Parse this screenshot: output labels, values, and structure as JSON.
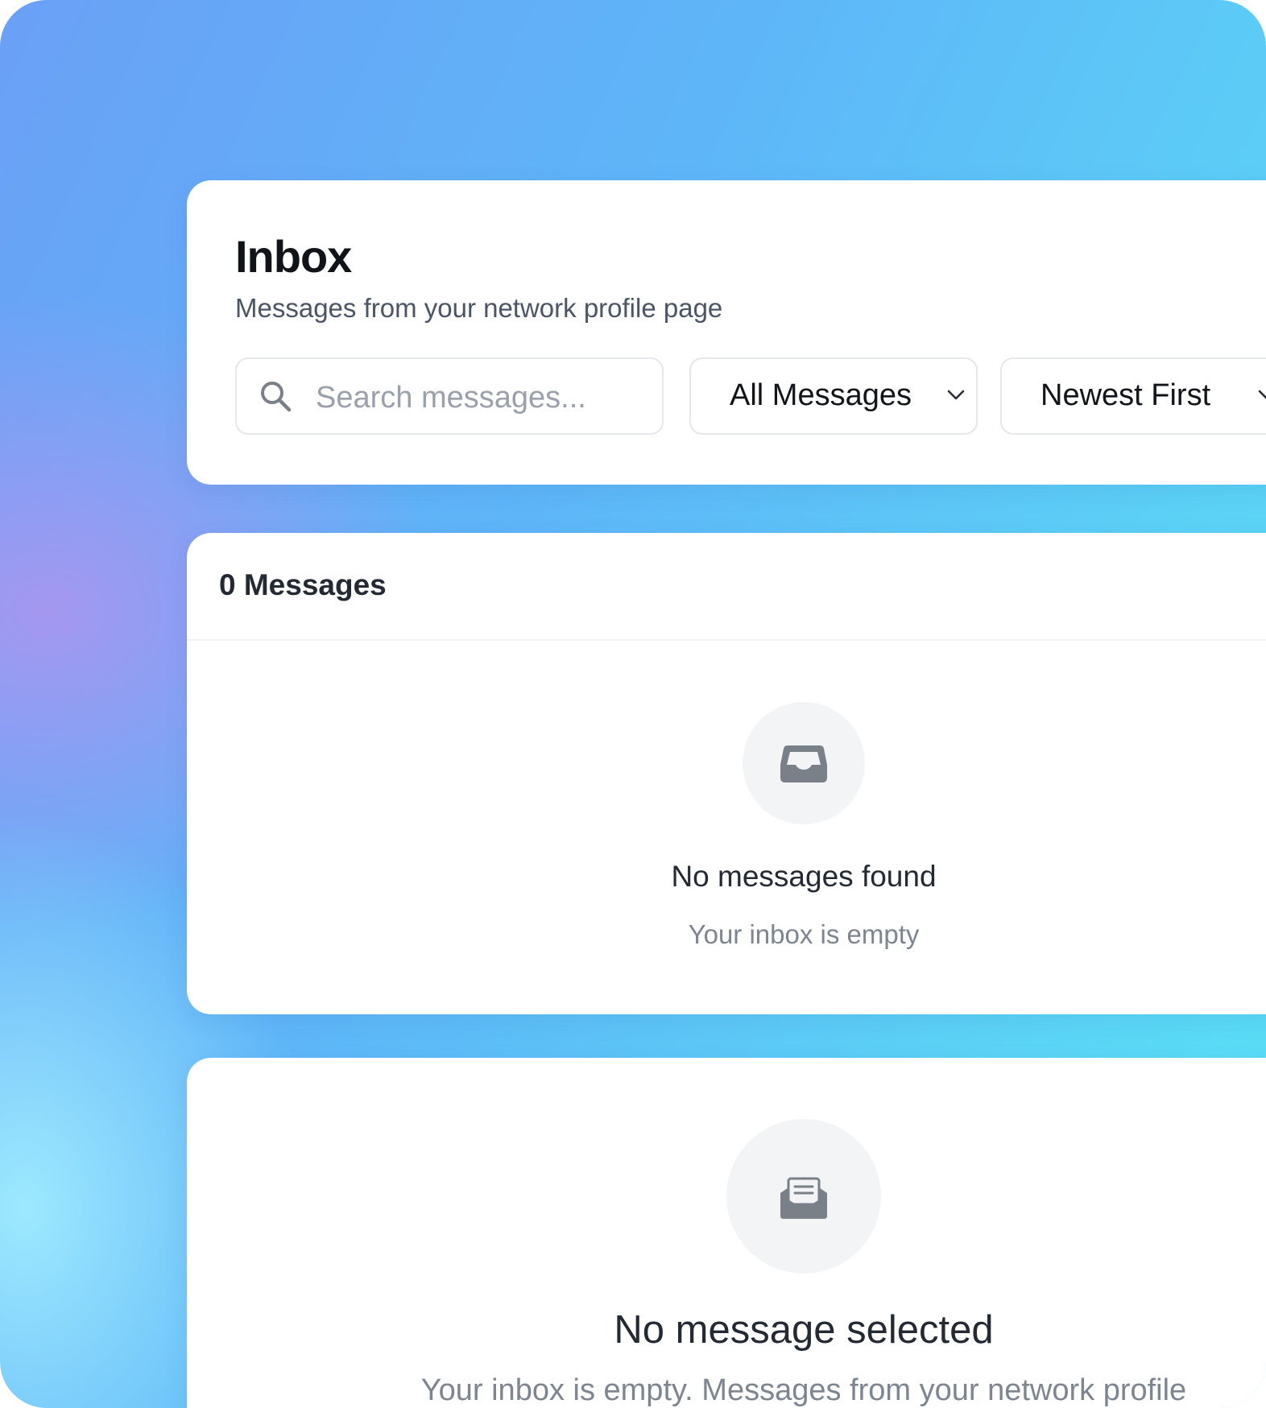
{
  "header": {
    "title": "Inbox",
    "subtitle": "Messages from your network profile page"
  },
  "search": {
    "placeholder": "Search messages...",
    "value": "",
    "icon": "search-icon"
  },
  "filter": {
    "selected": "All Messages",
    "icon": "chevron-down-icon"
  },
  "sort": {
    "selected": "Newest First",
    "icon": "chevron-down-icon"
  },
  "list": {
    "count_label": "0 Messages",
    "empty_icon": "inbox-tray-icon",
    "empty_title": "No messages found",
    "empty_subtitle": "Your inbox is empty"
  },
  "detail": {
    "empty_icon": "open-envelope-icon",
    "empty_title": "No message selected",
    "empty_subtitle": "Your inbox is empty. Messages from your network profile"
  },
  "colors": {
    "background_gradient_start": "#6aa0f6",
    "background_gradient_end": "#58e2f6",
    "card": "#ffffff",
    "icon_gray": "#7a8088",
    "text_primary": "#101418",
    "text_secondary": "#4a5565"
  }
}
